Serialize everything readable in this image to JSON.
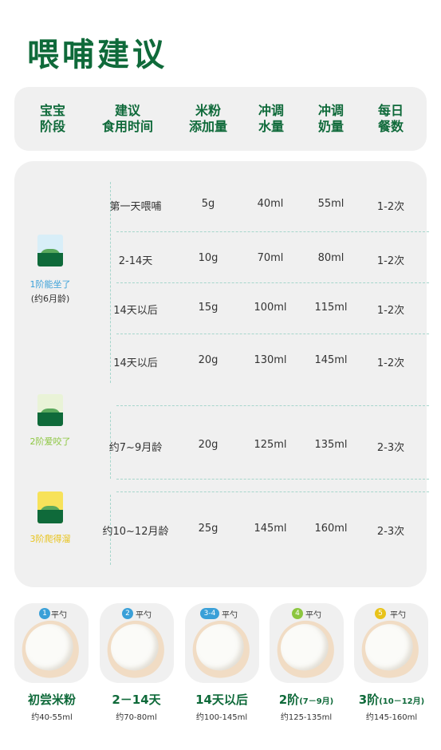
{
  "title": "喂哺建议",
  "header": {
    "c1": [
      "宝宝",
      "阶段"
    ],
    "c2": [
      "建议",
      "食用时间"
    ],
    "c3": [
      "米粉",
      "添加量"
    ],
    "c4": [
      "冲调",
      "水量"
    ],
    "c5": [
      "冲调",
      "奶量"
    ],
    "c6": [
      "每日",
      "餐数"
    ]
  },
  "stages": [
    {
      "name": "1阶能坐了",
      "sub": "(约6月龄)",
      "color": "#3aa0d8"
    },
    {
      "name": "2阶爱咬了",
      "sub": "",
      "color": "#8cc63f"
    },
    {
      "name": "3阶爬得溜",
      "sub": "",
      "color": "#e8c31a"
    }
  ],
  "rows": [
    {
      "time": "第一天喂哺",
      "amount": "5g",
      "water": "40ml",
      "milk": "55ml",
      "meals": "1-2次"
    },
    {
      "time": "2-14天",
      "amount": "10g",
      "water": "70ml",
      "milk": "80ml",
      "meals": "1-2次"
    },
    {
      "time": "14天以后",
      "amount": "15g",
      "water": "100ml",
      "milk": "115ml",
      "meals": "1-2次"
    },
    {
      "time": "14天以后",
      "amount": "20g",
      "water": "130ml",
      "milk": "145ml",
      "meals": "1-2次"
    },
    {
      "time": "约7~9月龄",
      "amount": "20g",
      "water": "125ml",
      "milk": "135ml",
      "meals": "2-3次"
    },
    {
      "time": "约10~12月龄",
      "amount": "25g",
      "water": "145ml",
      "milk": "160ml",
      "meals": "2-3次"
    }
  ],
  "spoons": [
    {
      "badge": "1",
      "ping": "平勺",
      "label": "初尝米粉",
      "amount": "约40-55ml",
      "color": "#3aa0d8"
    },
    {
      "badge": "2",
      "ping": "平勺",
      "label": "2－14天",
      "amount": "约70-80ml",
      "color": "#3aa0d8"
    },
    {
      "badge": "3-4",
      "ping": "平勺",
      "label": "14天以后",
      "amount": "约100-145ml",
      "color": "#3aa0d8"
    },
    {
      "badge": "4",
      "ping": "平勺",
      "label": "2阶",
      "label_sub": "(7－9月)",
      "amount": "约125-135ml",
      "color": "#8cc63f"
    },
    {
      "badge": "5",
      "ping": "平勺",
      "label": "3阶",
      "label_sub": "(10－12月)",
      "amount": "约145-160ml",
      "color": "#e8c31a"
    }
  ]
}
